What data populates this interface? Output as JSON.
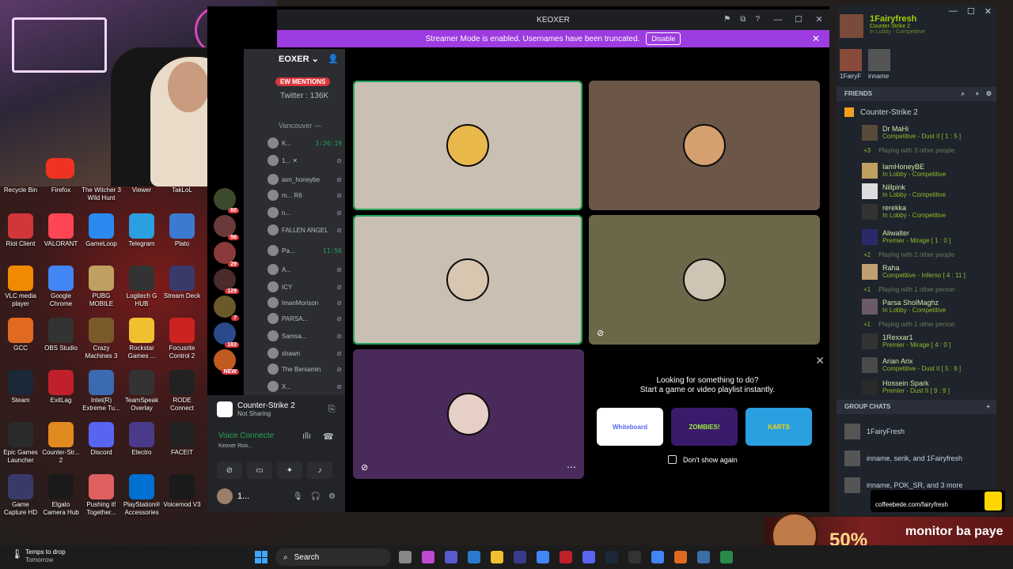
{
  "discord": {
    "window_title": "KEOXER",
    "streamer_banner": {
      "text": "Streamer Mode is enabled. Usernames have been truncated.",
      "button": "Disable"
    },
    "server_name": "EOXER",
    "mentions_badge": "EW MENTIONS",
    "twitter": "Twitter : 136K",
    "voice_channel": "Vancouver",
    "channel_users": [
      {
        "name": "K...",
        "time": "3:26:19"
      },
      {
        "name": "1... ✕"
      },
      {
        "name": "iam_honeybe"
      },
      {
        "name": "m... R6"
      },
      {
        "name": "n..."
      },
      {
        "name": "FALLEN ANGEL"
      },
      {
        "name": "Pa...",
        "time": "11:56"
      },
      {
        "name": "A..."
      },
      {
        "name": "ICY"
      },
      {
        "name": "ImanMorison"
      },
      {
        "name": "PARSA..."
      },
      {
        "name": "Samsa..."
      },
      {
        "name": "shawn"
      },
      {
        "name": "The Beniamin"
      },
      {
        "name": "X..."
      }
    ],
    "server_badges": [
      "60",
      "56",
      "29",
      "129",
      "7",
      "183",
      "NEW"
    ],
    "activity_panel": {
      "game": "Counter-Strike 2",
      "game_status": "Not Sharing",
      "voice_status": "Voice Connecte",
      "voice_room": "Keoxer Roo...",
      "user_short": "1..."
    },
    "call": {
      "promo_title": "Looking for something to do?",
      "promo_sub": "Start a game or video playlist instantly.",
      "activities": [
        "Whiteboard",
        "ZOMBIES!",
        "KARTS"
      ],
      "dont_show": "Don't show again"
    }
  },
  "steam": {
    "user": {
      "name": "1Fairyfresh",
      "game": "Counter-Strike 2",
      "status": "In Lobby - Competitive"
    },
    "party": [
      "1FairyF",
      "inname"
    ],
    "friends_header": "FRIENDS",
    "game_group": "Counter-Strike 2",
    "friends": [
      {
        "name": "Dr MaHi",
        "status": "Competitive - Dust II [ 1 : 5 ]"
      },
      {
        "name": "IamHoneyBE",
        "status": "In Lobby - Competitive"
      },
      {
        "name": "Nillpink",
        "status": "In Lobby - Competitive"
      },
      {
        "name": "rerekka",
        "status": "In Lobby - Competitive"
      },
      {
        "name": "Aliwalter",
        "status": "Premier - Mirage [ 1 : 0 ]"
      },
      {
        "name": "Raha",
        "status": "Competitive - Inferno [ 4 : 11 ]"
      },
      {
        "name": "Parsa SholMaghz",
        "status": "In Lobby - Competitive"
      },
      {
        "name": "1Rexxar1",
        "status": "Premier - Mirage [ 4 : 0 ]"
      },
      {
        "name": "Arian Arix",
        "status": "Competitive - Dust II [ 5 : 6 ]"
      },
      {
        "name": "Hossein Spark",
        "status": "Premier - Dust II [ 9 : 9 ]"
      }
    ],
    "more_rows": [
      {
        "count": "+3",
        "text": "Playing with 3 other people"
      },
      {
        "count": "+2",
        "text": "Playing with 2 other people"
      },
      {
        "count": "+1",
        "text": "Playing with 1 other person"
      },
      {
        "count": "+1",
        "text": "Playing with 1 other person"
      }
    ],
    "group_chats_header": "GROUP CHATS",
    "group_chats": [
      "1FairyFresh",
      "inname, serik, and 1Fairyfresh",
      "inname, POK_SR, and 3 more"
    ]
  },
  "desktop_icons": [
    "Recycle Bin",
    "Firefox",
    "The Witcher 3 Wild Hunt",
    "Viewer",
    "TakLoL",
    "Riot Client",
    "VALORANT",
    "GameLoop",
    "Telegram",
    "Plato",
    "VLC media player",
    "Google Chrome",
    "PUBG MOBILE",
    "Logitech G HUB",
    "Stream Deck",
    "GCC",
    "OBS Studio",
    "Crazy Machines 3",
    "Rockstar Games ...",
    "Focusrite Control 2",
    "Steam",
    "ExitLag",
    "Intel(R) Extreme Tu...",
    "TeamSpeak Overlay",
    "RODE Connect",
    "Epic Games Launcher",
    "Counter-Str... 2",
    "Discord",
    "Electro",
    "FACEIT",
    "Game Capture HD",
    "Elgato Camera Hub",
    "Pushing it! Together...",
    "PlayStation® Accessories",
    "Voicemod V3"
  ],
  "overlay": {
    "coffee_url": "coffeebede.com/fairyfresh",
    "promo_percent": "50%",
    "promo_title": "monitor ba paye"
  },
  "taskbar": {
    "weather_title": "Temps to drop",
    "weather_sub": "Tomorrow",
    "search": "Search"
  }
}
